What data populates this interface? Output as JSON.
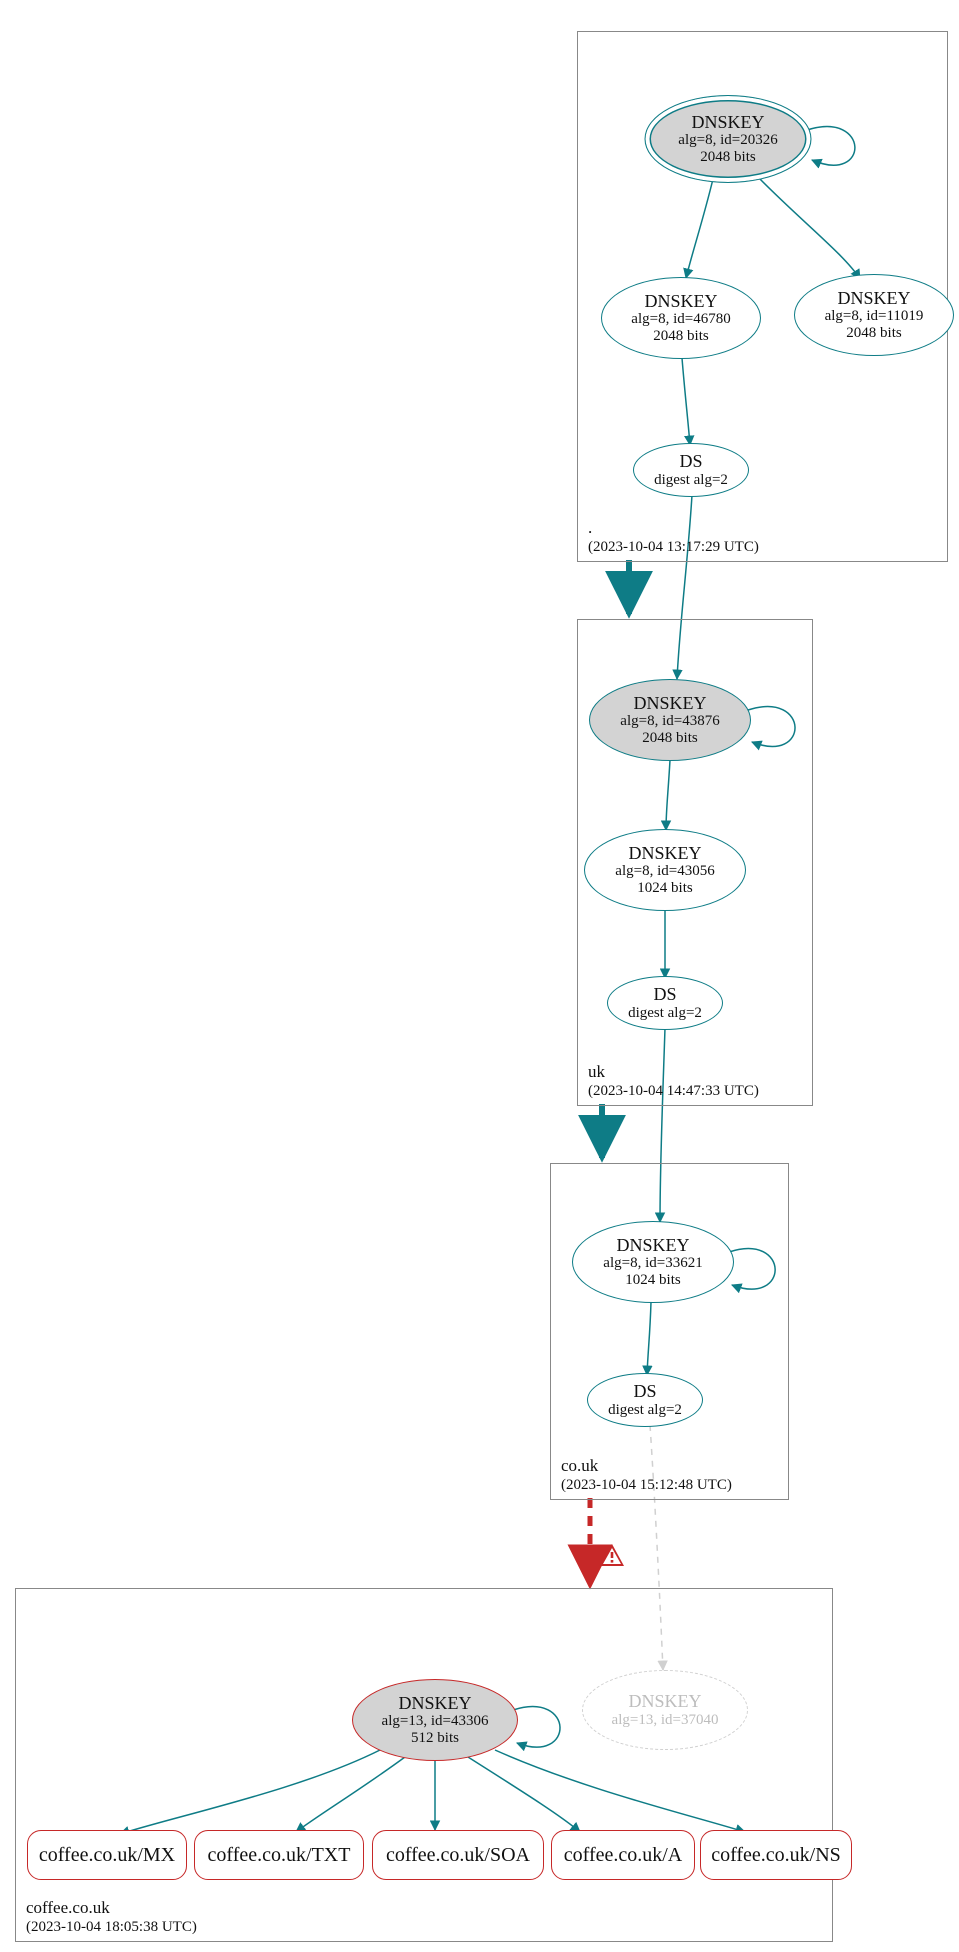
{
  "zones": {
    "root": {
      "name": ".",
      "timestamp": "(2023-10-04 13:17:29 UTC)"
    },
    "uk": {
      "name": "uk",
      "timestamp": "(2023-10-04 14:47:33 UTC)"
    },
    "couk": {
      "name": "co.uk",
      "timestamp": "(2023-10-04 15:12:48 UTC)"
    },
    "coffee": {
      "name": "coffee.co.uk",
      "timestamp": "(2023-10-04 18:05:38 UTC)"
    }
  },
  "nodes": {
    "root_ksk": {
      "title": "DNSKEY",
      "sub1": "alg=8, id=20326",
      "sub2": "2048 bits"
    },
    "root_zsk": {
      "title": "DNSKEY",
      "sub1": "alg=8, id=46780",
      "sub2": "2048 bits"
    },
    "root_other": {
      "title": "DNSKEY",
      "sub1": "alg=8, id=11019",
      "sub2": "2048 bits"
    },
    "root_ds": {
      "title": "DS",
      "sub1": "digest alg=2"
    },
    "uk_ksk": {
      "title": "DNSKEY",
      "sub1": "alg=8, id=43876",
      "sub2": "2048 bits"
    },
    "uk_zsk": {
      "title": "DNSKEY",
      "sub1": "alg=8, id=43056",
      "sub2": "1024 bits"
    },
    "uk_ds": {
      "title": "DS",
      "sub1": "digest alg=2"
    },
    "couk_key": {
      "title": "DNSKEY",
      "sub1": "alg=8, id=33621",
      "sub2": "1024 bits"
    },
    "couk_ds": {
      "title": "DS",
      "sub1": "digest alg=2"
    },
    "coffee_key": {
      "title": "DNSKEY",
      "sub1": "alg=13, id=43306",
      "sub2": "512 bits"
    },
    "coffee_ghost": {
      "title": "DNSKEY",
      "sub1": "alg=13, id=37040"
    },
    "rr_mx": {
      "label": "coffee.co.uk/MX"
    },
    "rr_txt": {
      "label": "coffee.co.uk/TXT"
    },
    "rr_soa": {
      "label": "coffee.co.uk/SOA"
    },
    "rr_a": {
      "label": "coffee.co.uk/A"
    },
    "rr_ns": {
      "label": "coffee.co.uk/NS"
    }
  }
}
